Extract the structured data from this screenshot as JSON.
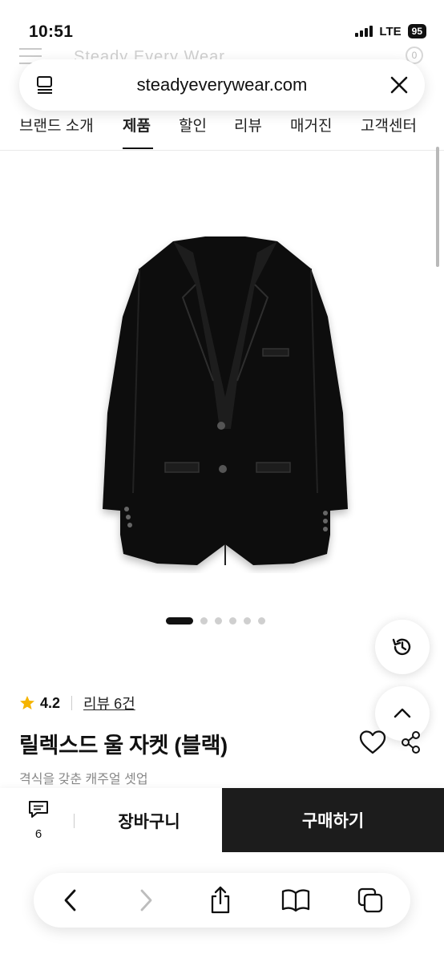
{
  "status_bar": {
    "time": "10:51",
    "network": "LTE",
    "battery": "95"
  },
  "ghost_header": {
    "brand": "Steady Every Wear",
    "cart_count": "0"
  },
  "url_bar": {
    "url": "steadyeverywear.com"
  },
  "nav": {
    "tabs": [
      {
        "label": "브랜드 소개"
      },
      {
        "label": "제품"
      },
      {
        "label": "할인"
      },
      {
        "label": "리뷰"
      },
      {
        "label": "매거진"
      },
      {
        "label": "고객센터"
      }
    ],
    "active_index": 1
  },
  "gallery": {
    "slide_count": 6,
    "active_slide": 1
  },
  "product": {
    "rating": "4.2",
    "review_link": "리뷰 6건",
    "title": "릴렉스드 울 자켓 (블랙)",
    "subtitle": "격식을 갖춘 캐주얼 셋업"
  },
  "action_bar": {
    "chat_count": "6",
    "cart_label": "장바구니",
    "buy_label": "구매하기"
  },
  "colors": {
    "accent_dark": "#1c1c1c",
    "star": "#f5b400"
  },
  "icons": [
    "reader-icon",
    "close-icon",
    "history-icon",
    "arrow-up-icon",
    "star-icon",
    "heart-icon",
    "share-icon",
    "chat-icon",
    "back-icon",
    "forward-icon",
    "share-sheet-icon",
    "bookmarks-icon",
    "tabs-icon"
  ]
}
